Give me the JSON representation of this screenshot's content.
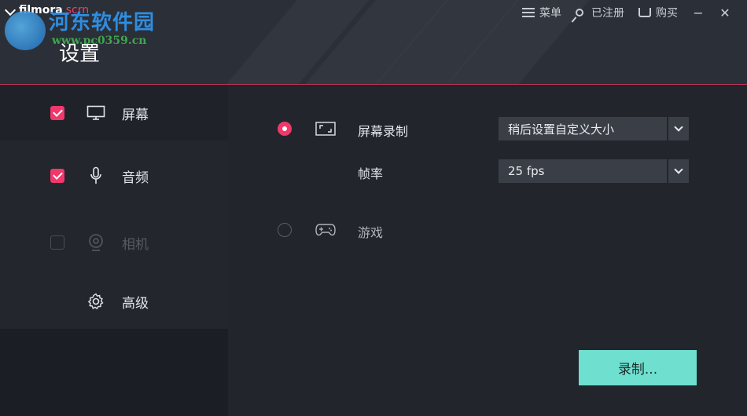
{
  "app": {
    "logo_main": "filmora",
    "logo_accent": "scrn"
  },
  "watermark": {
    "title": "河东软件园",
    "url": "www.pc0359.cn"
  },
  "header": {
    "title": "设置",
    "menu_label": "菜单",
    "register_label": "已注册",
    "buy_label": "购买",
    "minimize_glyph": "−",
    "close_glyph": "✕"
  },
  "sidebar": {
    "items": [
      {
        "label": "屏幕",
        "checked": true,
        "icon": "monitor-icon"
      },
      {
        "label": "音频",
        "checked": true,
        "icon": "microphone-icon"
      },
      {
        "label": "相机",
        "checked": false,
        "disabled": true,
        "icon": "webcam-icon"
      },
      {
        "label": "高级",
        "icon": "gear-icon"
      }
    ]
  },
  "main": {
    "screen_option": {
      "label": "屏幕录制",
      "selected": true,
      "icon": "fullscreen-icon",
      "size_select": "稍后设置自定义大小"
    },
    "framerate": {
      "label": "帧率",
      "value": "25 fps"
    },
    "game_option": {
      "label": "游戏",
      "selected": false,
      "icon": "gamepad-icon"
    },
    "record_button": "录制..."
  },
  "colors": {
    "accent": "#f0386b",
    "record_button": "#6fe0cf",
    "header_bg": "#2b2f37",
    "sidebar_bg": "#1b1e24",
    "main_bg": "#22252c"
  }
}
